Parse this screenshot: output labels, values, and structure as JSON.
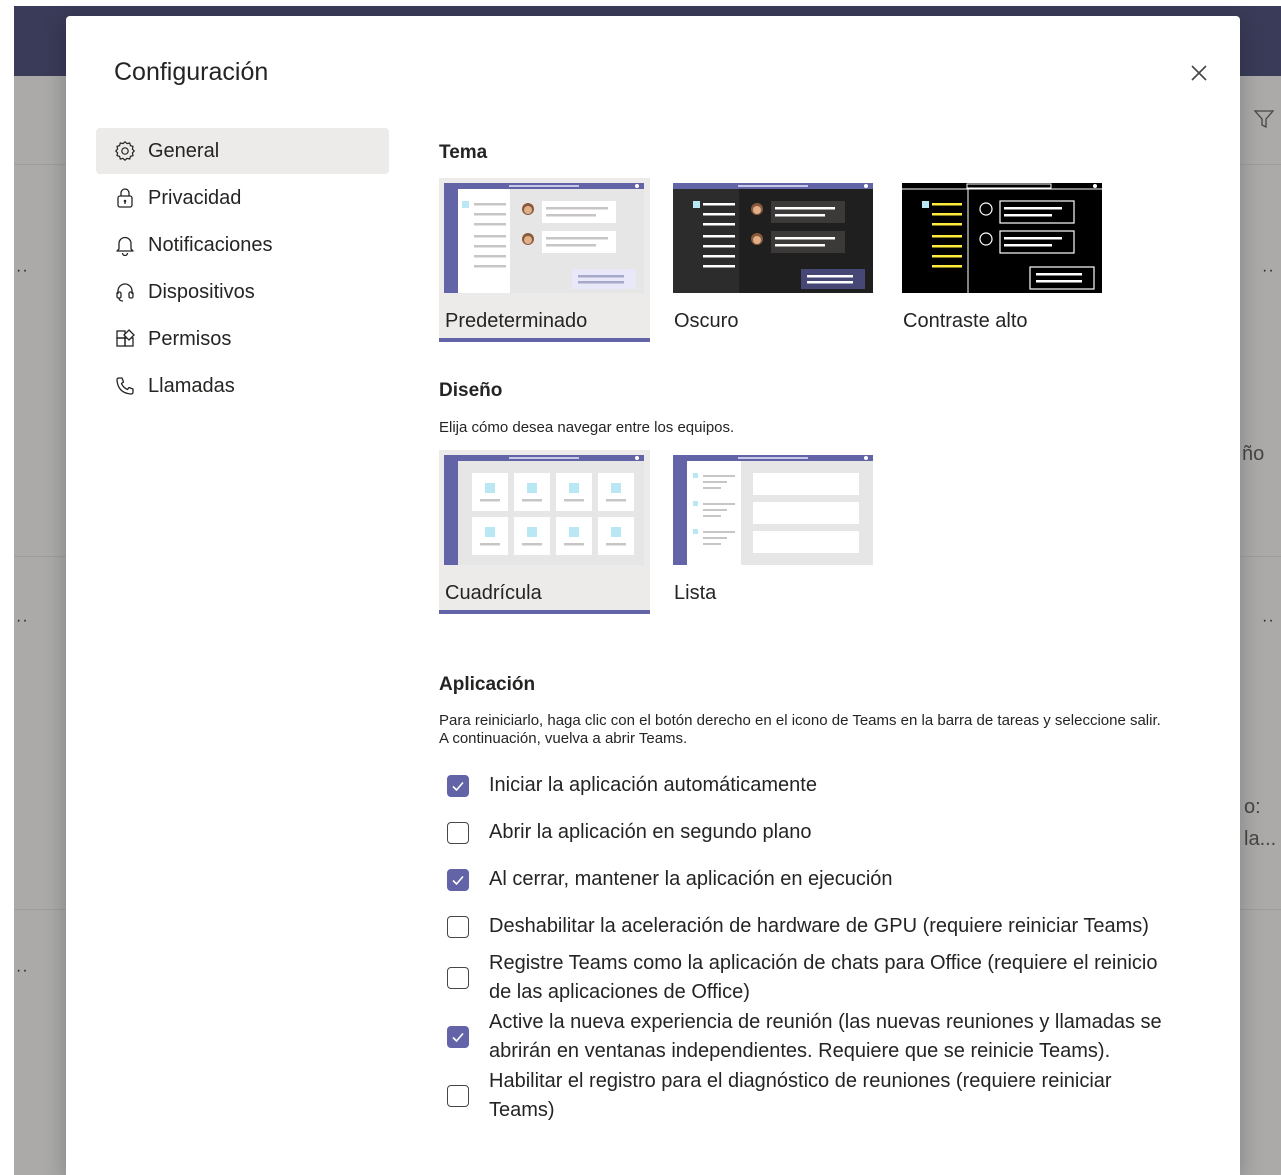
{
  "background": {
    "partial_text_1": "ño",
    "partial_text_2": "o:",
    "partial_text_3": "la..."
  },
  "modal": {
    "title": "Configuración",
    "close_icon": "close-icon"
  },
  "nav": {
    "items": [
      {
        "label": "General",
        "icon": "gear-icon",
        "selected": true
      },
      {
        "label": "Privacidad",
        "icon": "lock-icon",
        "selected": false
      },
      {
        "label": "Notificaciones",
        "icon": "bell-icon",
        "selected": false
      },
      {
        "label": "Dispositivos",
        "icon": "headset-icon",
        "selected": false
      },
      {
        "label": "Permisos",
        "icon": "apps-icon",
        "selected": false
      },
      {
        "label": "Llamadas",
        "icon": "phone-icon",
        "selected": false
      }
    ]
  },
  "theme": {
    "title": "Tema",
    "options": [
      {
        "label": "Predeterminado",
        "selected": true
      },
      {
        "label": "Oscuro",
        "selected": false
      },
      {
        "label": "Contraste alto",
        "selected": false
      }
    ]
  },
  "layout": {
    "title": "Diseño",
    "description": "Elija cómo desea navegar entre los equipos.",
    "options": [
      {
        "label": "Cuadrícula",
        "selected": true
      },
      {
        "label": "Lista",
        "selected": false
      }
    ]
  },
  "application": {
    "title": "Aplicación",
    "description": "Para reiniciarlo, haga clic con el botón derecho en el icono de Teams en la barra de tareas y seleccione salir. A continuación, vuelva a abrir Teams.",
    "checkboxes": [
      {
        "label": "Iniciar la aplicación automáticamente",
        "checked": true
      },
      {
        "label": "Abrir la aplicación en segundo plano",
        "checked": false
      },
      {
        "label": "Al cerrar, mantener la aplicación en ejecución",
        "checked": true
      },
      {
        "label": "Deshabilitar la aceleración de hardware de GPU (requiere reiniciar Teams)",
        "checked": false
      },
      {
        "label": "Registre Teams como la aplicación de chats para Office (requiere el reinicio de las aplicaciones de Office)",
        "checked": false
      },
      {
        "label": "Active la nueva experiencia de reunión (las nuevas reuniones y llamadas se abrirán en ventanas independientes. Requiere que se reinicie Teams).",
        "checked": true
      },
      {
        "label": "Habilitar el registro para el diagnóstico de reuniones (requiere reiniciar Teams)",
        "checked": false
      }
    ]
  },
  "colors": {
    "accent": "#6264a7",
    "topbar": "#464775",
    "selected_bg": "#edebe9"
  }
}
